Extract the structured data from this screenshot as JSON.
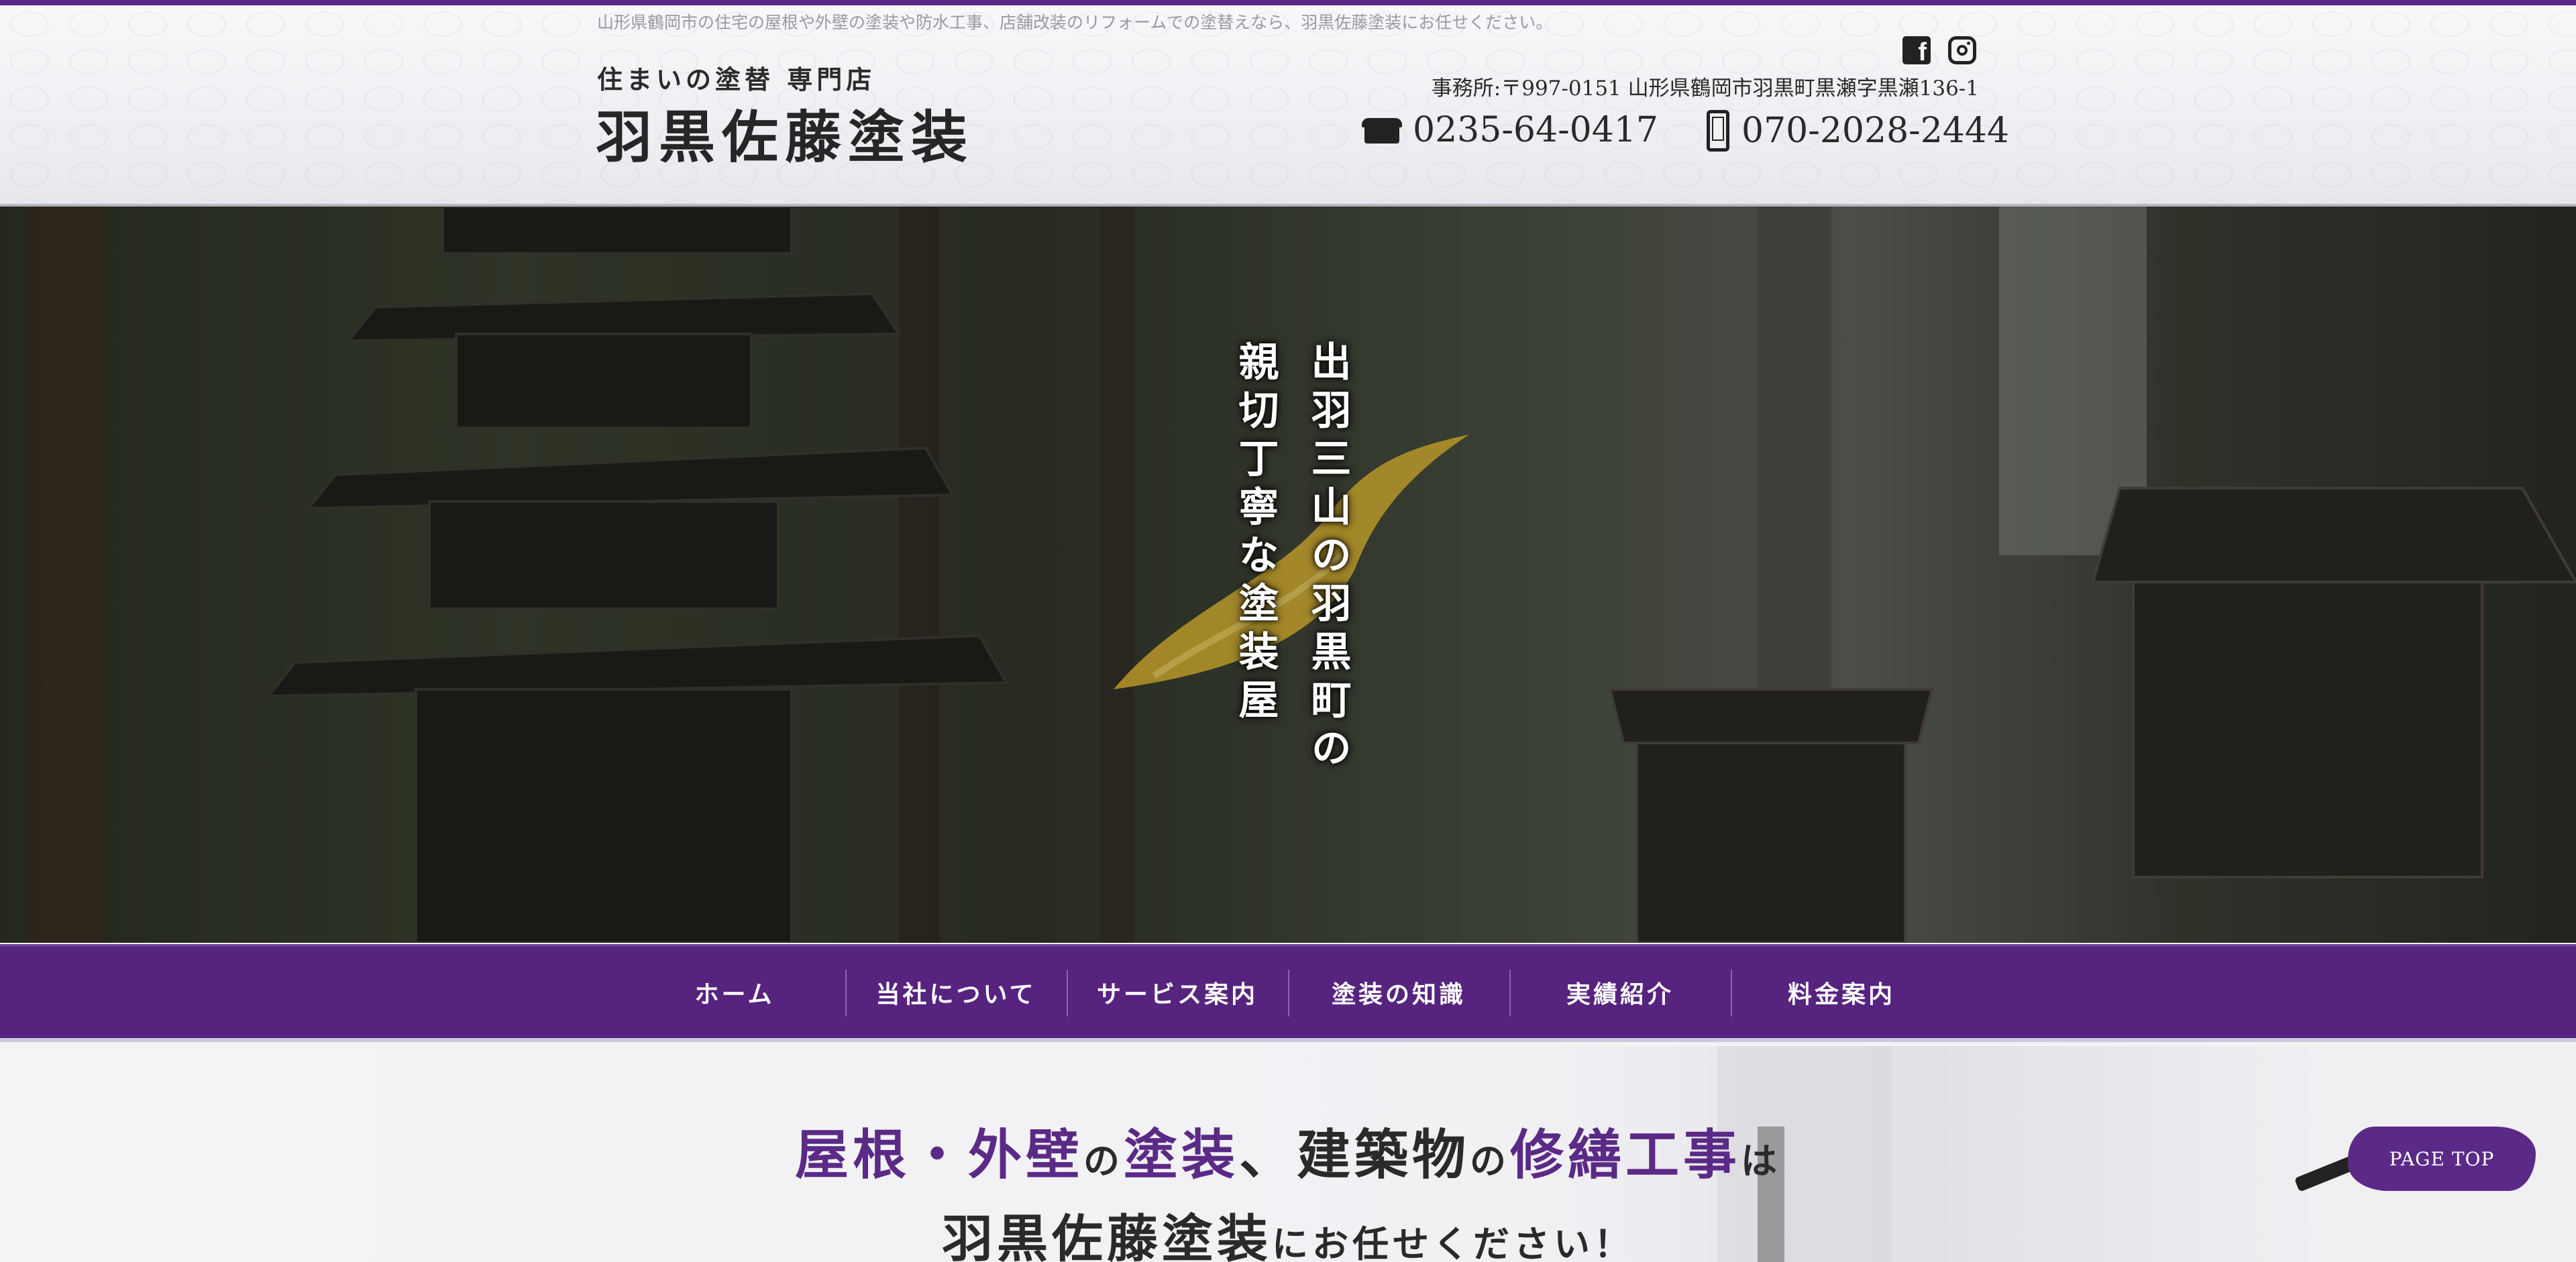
{
  "site": {
    "tagline": "山形県鶴岡市の住宅の屋根や外壁の塗装や防水工事、店舗改装のリフォームでの塗替えなら、羽黒佐藤塗装にお任せください。",
    "logo_sub": "住まいの塗替 専門店",
    "logo_main": "羽黒佐藤塗装",
    "address": "事務所:〒997-0151 山形県鶴岡市羽黒町黒瀬字黒瀬136-1",
    "phone_landline": "0235-64-0417",
    "phone_mobile": "070-2028-2444",
    "social": [
      "facebook-icon",
      "instagram-icon"
    ]
  },
  "hero": {
    "copy_line1": "出羽三山の羽黒町の",
    "copy_line2": "親切丁寧な塗装屋"
  },
  "nav": {
    "items": [
      {
        "label": "ホーム"
      },
      {
        "label": "当社について"
      },
      {
        "label": "サービス案内"
      },
      {
        "label": "塗装の知識"
      },
      {
        "label": "実績紹介"
      },
      {
        "label": "料金案内"
      }
    ]
  },
  "headline": {
    "p1": "屋根・外壁",
    "p2": "の",
    "p3": "塗装",
    "p4": "、",
    "p5": "建築物",
    "p6": "の",
    "p7": "修繕工事",
    "p8": "は",
    "q1": "羽黒佐藤塗装",
    "q2": "にお任せください！"
  },
  "page_top": {
    "label": "PAGE TOP"
  },
  "colors": {
    "brand_purple": "#56237f",
    "gold_brush": "#d6b032"
  }
}
